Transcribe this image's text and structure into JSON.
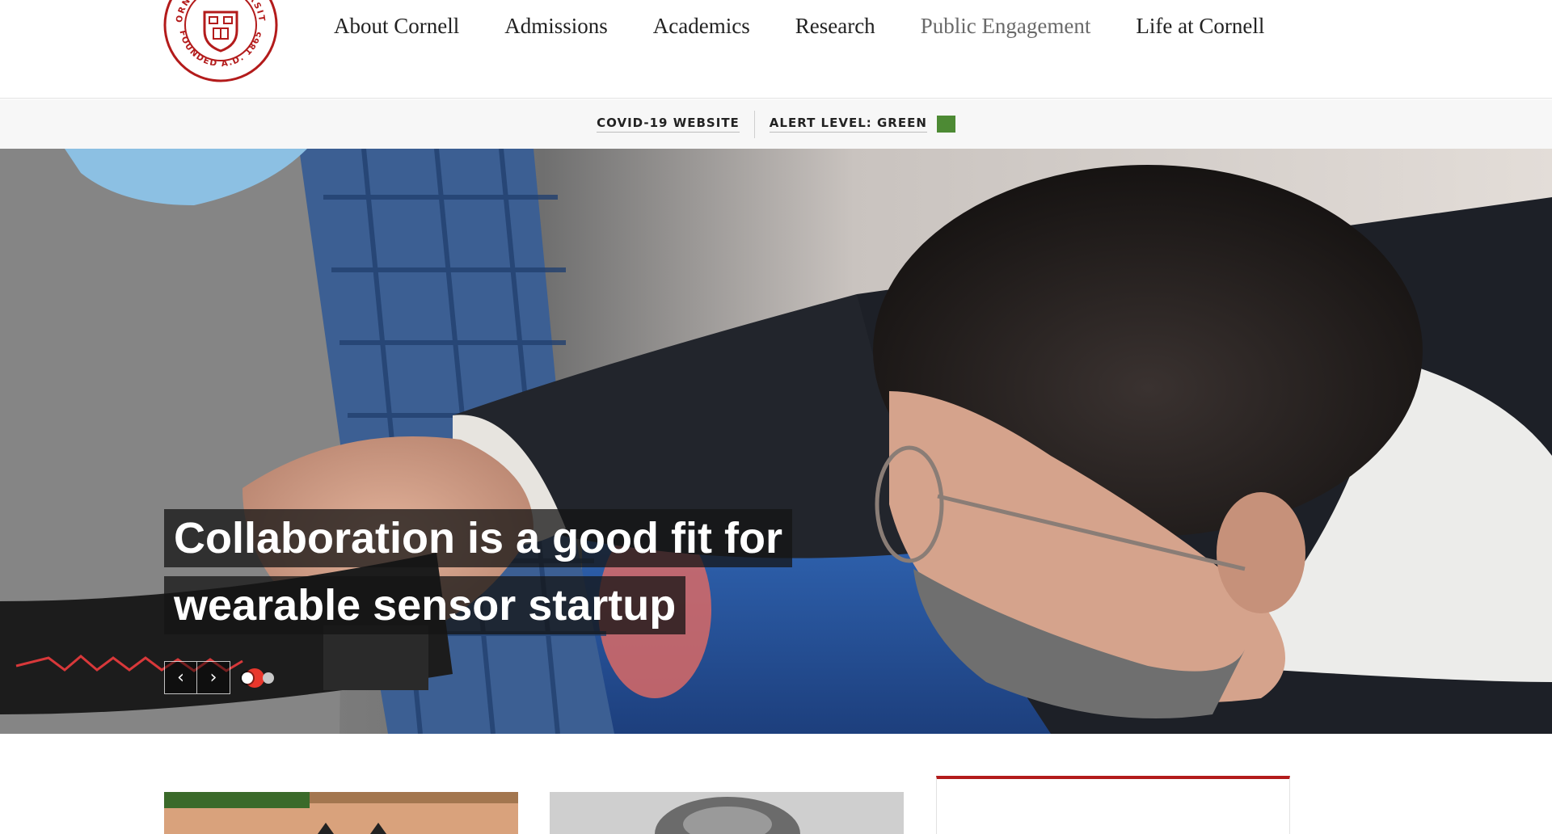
{
  "logo": {
    "text_top": "CORNELL UNIVERSITY",
    "text_bottom": "FOUNDED A.D. 1865",
    "color": "#b31b1b"
  },
  "nav": {
    "items": [
      {
        "label": "About Cornell"
      },
      {
        "label": "Admissions"
      },
      {
        "label": "Academics"
      },
      {
        "label": "Research"
      },
      {
        "label": "Public Engagement"
      },
      {
        "label": "Life at Cornell"
      }
    ]
  },
  "alert": {
    "covid_link": "COVID-19 WEBSITE",
    "level_label": "ALERT LEVEL: GREEN",
    "level_color": "#4d8a34"
  },
  "hero": {
    "headline": "Collaboration is a good fit for wearable sensor startup",
    "prev_icon": "chevron-left-icon",
    "next_icon": "chevron-right-icon",
    "slide_count": 2,
    "active_slide": 1
  },
  "colors": {
    "brand_red": "#b31b1b",
    "text_dark": "#222222",
    "alert_bg": "#f7f7f7"
  }
}
